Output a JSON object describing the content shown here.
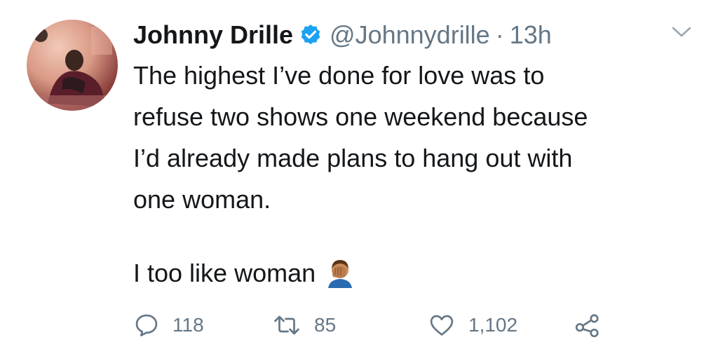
{
  "tweet": {
    "author_name": "Johnny Drille",
    "handle": "@Johnnydrille",
    "separator": "·",
    "time": "13h",
    "text_paragraph_1": "The highest I’ve done for love was to\nrefuse two shows one weekend because\nI’d already made plans to hang out with\none woman.",
    "text_paragraph_2": "I too like woman",
    "emoji": "face-palm-emoji",
    "verified_color": "#1da1f2"
  },
  "actions": {
    "reply_count": "118",
    "retweet_count": "85",
    "like_count": "1,102"
  },
  "icons": {
    "reply": "reply-icon",
    "retweet": "retweet-icon",
    "like": "heart-icon",
    "share": "share-icon",
    "menu": "chevron-down-icon",
    "verified": "verified-badge-icon"
  }
}
